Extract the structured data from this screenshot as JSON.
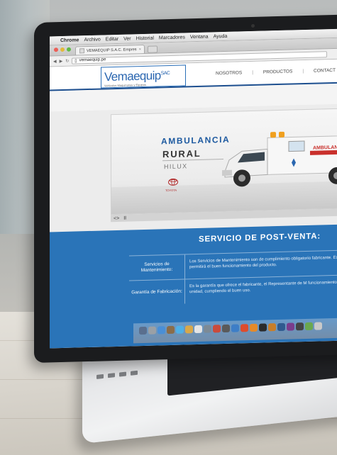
{
  "menubar": {
    "apple": "",
    "app": "Chrome",
    "items": [
      "Archivo",
      "Editar",
      "Ver",
      "Historial",
      "Marcadores",
      "Ventana",
      "Ayuda"
    ]
  },
  "tab": {
    "title": "VEMAEQUIP S.A.C. Empres",
    "close": "×"
  },
  "address": {
    "url": "vemaequip.pe"
  },
  "site": {
    "logo_name": "Vemaequip",
    "logo_suffix": "SAC",
    "logo_tagline": "Vehículos Maquinarias y Equipos",
    "nav": [
      "NOSOTROS",
      "PRODUCTOS",
      "CONTACT"
    ]
  },
  "hero": {
    "title": "AMBULANCIA",
    "subtitle": "RURAL",
    "model": "HILUX",
    "brand": "TOYOTA",
    "truck_label": "AMBULANCIA",
    "controls": [
      "<>",
      "II"
    ]
  },
  "post_venta": {
    "title": "SERVICIO DE POST-VENTA:",
    "rows": [
      {
        "key": "Servicios de Mantenimiento:",
        "value": "Los Servicios de Mantenimiento son de cumplimiento obligatorio fabricante. Esto permitirá el buen funcionamiento del producto."
      },
      {
        "key": "Garantía de Fabricación:",
        "value": "Es la garantía que ofrece el fabricante, el Representante de M funcionamiento de la unidad, cumpliendo el buen uso."
      }
    ]
  },
  "colors": {
    "brand_blue": "#2a74b8",
    "header_blue": "#1d4f8f",
    "logo_blue": "#2a66b0"
  }
}
